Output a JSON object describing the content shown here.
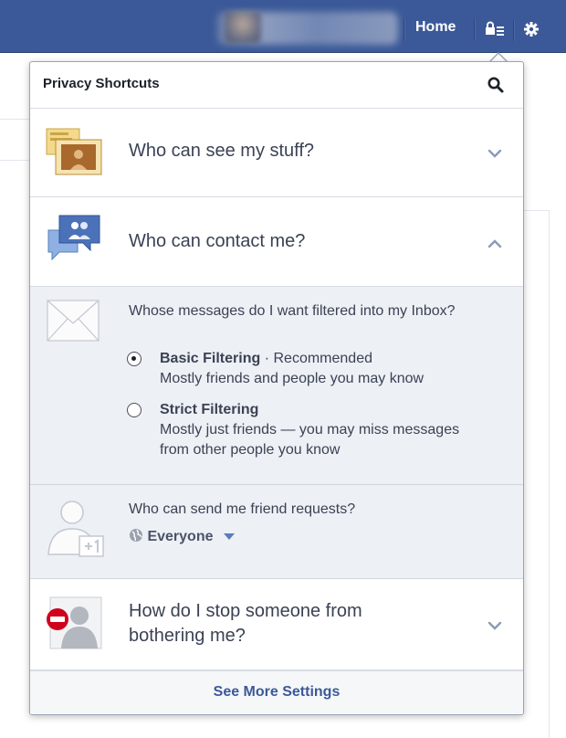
{
  "topbar": {
    "home_label": "Home",
    "privacy_icon": "lock-list-icon",
    "settings_icon": "gear-icon",
    "bar_color": "#3b5998"
  },
  "popup": {
    "title": "Privacy Shortcuts",
    "search_icon": "search-icon",
    "sections": [
      {
        "label": "Who can see my stuff?",
        "icon": "stacked-photos-icon",
        "state": "collapsed"
      },
      {
        "label": "Who can contact me?",
        "icon": "chat-bubbles-icon",
        "state": "expanded"
      },
      {
        "label": "How do I stop someone from bothering me?",
        "icon": "block-user-icon",
        "state": "collapsed"
      }
    ],
    "messages": {
      "icon": "envelope-icon",
      "question": "Whose messages do I want filtered into my Inbox?",
      "options": [
        {
          "title": "Basic Filtering",
          "separator": "·",
          "note": "Recommended",
          "desc": "Mostly friends and people you may know",
          "selected": true
        },
        {
          "title": "Strict Filtering",
          "separator": "",
          "note": "",
          "desc": "Mostly just friends — you may miss messages from other people you know",
          "selected": false
        }
      ]
    },
    "friend_requests": {
      "icon": "add-friend-icon",
      "question": "Who can send me friend requests?",
      "audience": "Everyone",
      "audience_icon": "globe-icon"
    },
    "footer_link": "See More Settings"
  },
  "colors": {
    "accent": "#3b5998",
    "expanded_bg": "#edf0f5",
    "text": "#3b4254",
    "block_red": "#d0021b"
  }
}
